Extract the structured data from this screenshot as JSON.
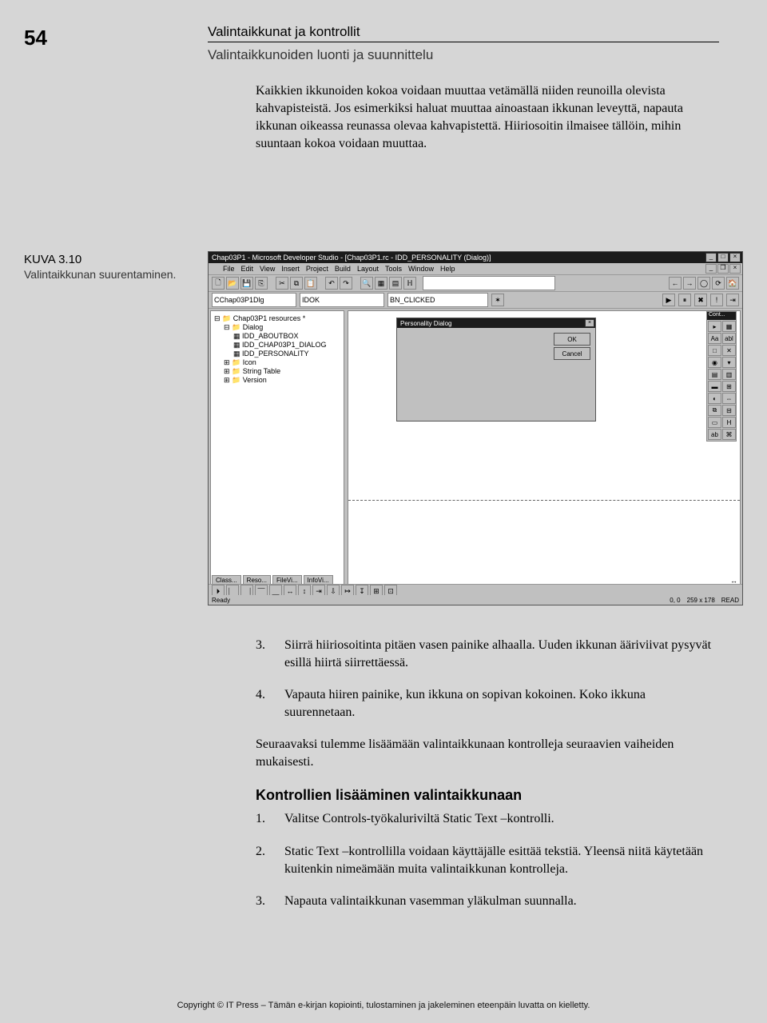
{
  "page_number": "54",
  "chapter_title": "Valintaikkunat ja kontrollit",
  "subtitle": "Valintaikkunoiden luonti ja suunnittelu",
  "intro_paragraph": "Kaikkien ikkunoiden kokoa voidaan muuttaa vetämällä niiden reunoilla olevista kahvapisteistä. Jos esimerkiksi haluat muuttaa ainoastaan ikkunan leveyttä, napauta ikkunan oikeassa reunassa olevaa kahvapistettä. Hiiriosoitin ilmaisee tällöin, mihin suuntaan kokoa voidaan muuttaa.",
  "caption_title": "KUVA 3.10",
  "caption_sub": "Valintaikkunan suurentaminen.",
  "screenshot": {
    "title": "Chap03P1 - Microsoft Developer Studio - [Chap03P1.rc - IDD_PERSONALITY (Dialog)]",
    "menus": [
      "File",
      "Edit",
      "View",
      "Insert",
      "Project",
      "Build",
      "Layout",
      "Tools",
      "Window",
      "Help"
    ],
    "combo_class": "CChap03P1Dlg",
    "combo_id": "IDOK",
    "combo_msg": "BN_CLICKED",
    "tree": {
      "root": "Chap03P1 resources *",
      "dialog": "Dialog",
      "items": [
        "IDD_ABOUTBOX",
        "IDD_CHAP03P1_DIALOG",
        "IDD_PERSONALITY"
      ],
      "icon": "Icon",
      "stringtable": "String Table",
      "version": "Version"
    },
    "dialog_title": "Personality Dialog",
    "ok_button": "OK",
    "cancel_button": "Cancel",
    "palette_title": "Cont...",
    "palette_items": [
      "▸",
      "▦",
      "Aa",
      "abl",
      "□",
      "✕",
      "◉",
      "▾",
      "▤",
      "▥",
      "▬",
      "⊞",
      "◐",
      "⇔",
      "⧉",
      "⊟",
      "▭",
      "H",
      "ab",
      "⌘"
    ],
    "tabs": [
      "Class...",
      "Reso...",
      "FileVi...",
      "InfoVi..."
    ],
    "status_left": "Ready",
    "status_cursor": "0, 0",
    "status_size": "259 x 178",
    "status_mode": "READ"
  },
  "list_a": [
    {
      "num": "3.",
      "text": "Siirrä hiiriosoitinta pitäen vasen painike alhaalla. Uuden ikkunan ääriviivat pysyvät esillä hiirtä siirrettäessä."
    },
    {
      "num": "4.",
      "text": "Vapauta hiiren painike, kun ikkuna on sopivan kokoinen. Koko ikkuna suurennetaan."
    }
  ],
  "mid_paragraph": "Seuraavaksi tulemme lisäämään valintaikkunaan kontrolleja seuraavien vaiheiden mukaisesti.",
  "section_heading": "Kontrollien lisääminen valintaikkunaan",
  "list_b": [
    {
      "num": "1.",
      "text": "Valitse Controls-työkaluriviltä Static Text –kontrolli."
    },
    {
      "num": "2.",
      "text": "Static Text –kontrollilla voidaan käyttäjälle esittää tekstiä. Yleensä niitä käytetään kuitenkin nimeämään muita valinta­ikkunan kontrolleja."
    },
    {
      "num": "3.",
      "text": "Napauta valintaikkunan vasemman yläkulman suunnalla."
    }
  ],
  "footer": "Copyright © IT Press – Tämän e-kirjan kopiointi, tulostaminen ja jakeleminen eteenpäin luvatta on kielletty."
}
